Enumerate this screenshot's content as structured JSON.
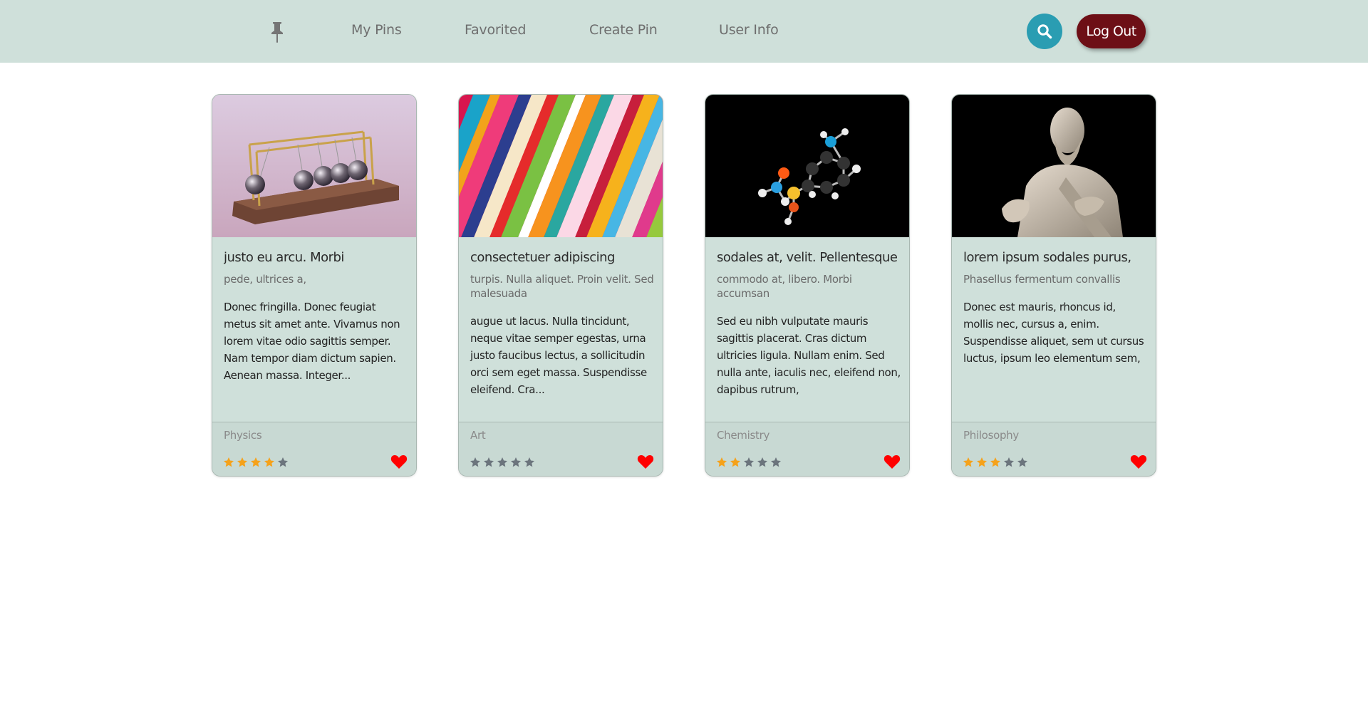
{
  "nav": {
    "brand_icon": "pushpin-icon",
    "links": [
      "My Pins",
      "Favorited",
      "Create Pin",
      "User Info"
    ],
    "search_icon": "search-icon",
    "logout_label": "Log Out",
    "colors": {
      "navbar": "#cfe0da",
      "search": "#2a9db2",
      "logout": "#6d0f16"
    }
  },
  "cards": [
    {
      "image": "newtons-cradle-image",
      "title": "justo eu arcu. Morbi",
      "subtitle": "pede, ultrices a,",
      "body": "Donec fringilla. Donec feugiat metus sit amet ante. Vivamus non lorem vitae odio sagittis semper. Nam tempor diam dictum sapien. Aenean massa. Integer...",
      "category": "Physics",
      "rating": 4,
      "max_rating": 5,
      "favorited": true
    },
    {
      "image": "colorful-stripes-image",
      "title": "consectetuer adipiscing",
      "subtitle": "turpis. Nulla aliquet. Proin velit. Sed malesuada",
      "body": "augue ut lacus. Nulla tincidunt, neque vitae semper egestas, urna justo faucibus lectus, a sollicitudin orci sem eget massa. Suspendisse eleifend. Cra...",
      "category": "Art",
      "rating": 0,
      "max_rating": 5,
      "favorited": true
    },
    {
      "image": "molecule-model-image",
      "title": "sodales at, velit. Pellentesque",
      "subtitle": "commodo at, libero. Morbi accumsan",
      "body": "Sed eu nibh vulputate mauris sagittis placerat. Cras dictum ultricies ligula. Nullam enim. Sed nulla ante, iaculis nec, eleifend non, dapibus rutrum,",
      "category": "Chemistry",
      "rating": 2,
      "max_rating": 5,
      "favorited": true
    },
    {
      "image": "philosopher-statue-image",
      "title": "lorem ipsum sodales purus,",
      "subtitle": "Phasellus fermentum convallis",
      "body": "Donec est mauris, rhoncus id, mollis nec, cursus a, enim. Suspendisse aliquet, sem ut cursus luctus, ipsum leo elementum sem,",
      "category": "Philosophy",
      "rating": 3,
      "max_rating": 5,
      "favorited": true
    }
  ],
  "colors": {
    "star_on": "#f5a21b",
    "star_off": "#6c757d",
    "heart": "#ff0000"
  }
}
